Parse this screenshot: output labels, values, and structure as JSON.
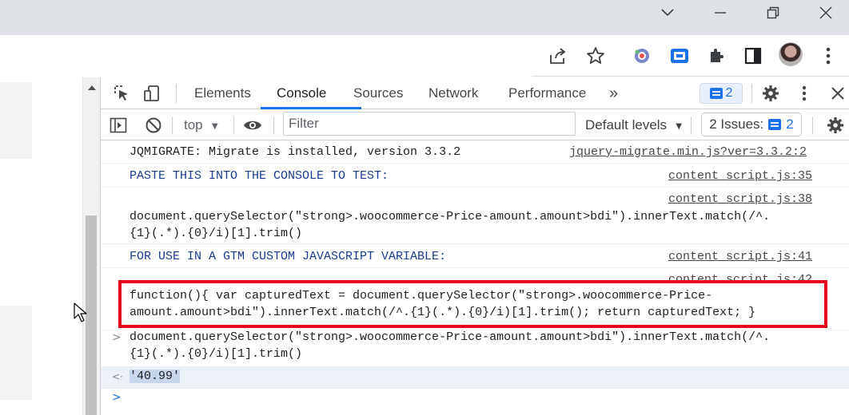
{
  "window": {
    "controls": [
      "chevron-down",
      "minimize",
      "restore",
      "close"
    ]
  },
  "browser_toolbar": {
    "icons": [
      "share-icon",
      "star-icon",
      "extension-colorful-icon",
      "extension-tag-icon",
      "puzzle-icon",
      "side-panel-icon",
      "profile-avatar",
      "more-vert-icon"
    ]
  },
  "devtools": {
    "tabs": [
      {
        "label": "Elements"
      },
      {
        "label": "Console",
        "active": true
      },
      {
        "label": "Sources"
      },
      {
        "label": "Network"
      },
      {
        "label": "Performance"
      }
    ],
    "more_tabs": "»",
    "issues_badge_count": "2",
    "console_toolbar": {
      "context": "top",
      "filter_placeholder": "Filter",
      "levels": "Default levels",
      "issues_label": "2 Issues:",
      "issues_count": "2"
    },
    "accent_color": "#1a73e8",
    "highlight_color": "#e3001b"
  },
  "console": {
    "messages": [
      {
        "text": "JQMIGRATE: Migrate is installed, version 3.3.2",
        "source": "jquery-migrate.min.js?ver=3.3.2:2"
      },
      {
        "text": "PASTE THIS INTO THE CONSOLE TO TEST:",
        "source": "content_script.js:35"
      },
      {
        "source": "content_script.js:38",
        "line1": "document.querySelector(\"strong>.woocommerce-Price-amount.amount>bdi\").innerText.match(/^.",
        "line2": "{1}(.*).{0}/i)[1].trim()"
      },
      {
        "text": "FOR USE IN A GTM CUSTOM JAVASCRIPT VARIABLE:",
        "source": "content_script.js:41"
      },
      {
        "source": "content_script.js:42",
        "line1": "function(){ var capturedText = document.querySelector(\"strong>.woocommerce-Price-",
        "line2": "amount.amount>bdi\").innerText.match(/^.{1}(.*).{0}/i)[1].trim(); return capturedText; }"
      }
    ],
    "input": {
      "prompt": ">",
      "line1": "document.querySelector(\"strong>.woocommerce-Price-amount.amount>bdi\").innerText.match(/^.",
      "line2": "{1}(.*).{0}/i)[1].trim()"
    },
    "result": {
      "prompt": "<·",
      "value": "'40.99'"
    },
    "empty_prompt": ">"
  }
}
